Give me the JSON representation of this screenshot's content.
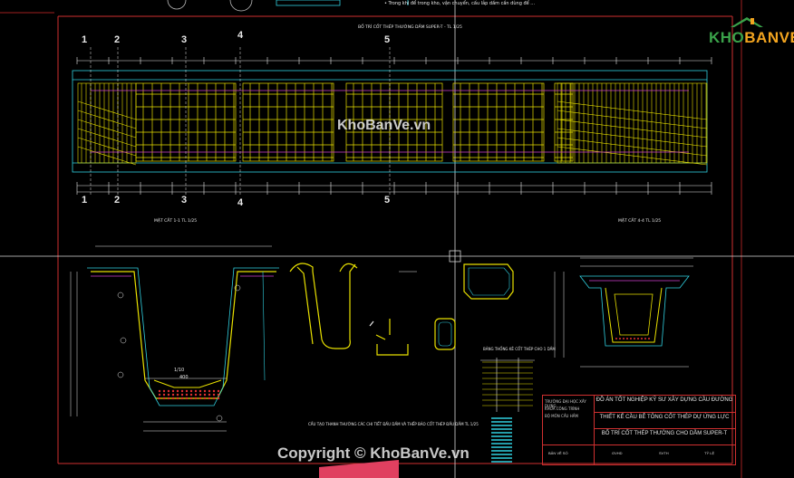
{
  "sheet": {
    "top_note": "• Trong khi để trong kho, vận chuyển, cấu lắp dầm cần dùng để ...",
    "plan_title": "BỐ TRÍ CỐT THÉP THƯỜNG DẦM SUPER-T - TL 1/25",
    "section_numbers_top": [
      "1",
      "2",
      "3",
      "4",
      "5"
    ],
    "section_numbers_bottom": [
      "1",
      "2",
      "3",
      "4",
      "5"
    ],
    "cross_section_left_label": "MẶT CẮT 1-1  TL 1/25",
    "cross_section_right_label": "MẶT CẮT 4-4  TL 1/25",
    "dim_width": "400",
    "dim_top": "1/10",
    "rebar_detail_note": "CẤU TẠO THANH THƯỜNG CÁC CHI TIẾT ĐẦU DẦM VÀ THẾP BẢO CỐT THÉP ĐẦU DẦM  TL 1/25",
    "table_title": "BẢNG THỐNG KÊ CỐT THÉP CHO 1 DẦM"
  },
  "title_block": {
    "left_lines": [
      "TRƯỜNG ĐẠI HỌC XÂY DỰNG",
      "KHOA CÔNG TRÌNH",
      "BỘ MÔN CẦU HẦM"
    ],
    "project": "ĐỒ ÁN TỐT NGHIỆP KỸ SƯ XÂY DỰNG CẦU ĐƯỜNG",
    "design": "THIẾT KẾ CẦU BÊ TÔNG CỐT THÉP DỰ ỨNG LỰC",
    "drawing": "BỐ TRÍ CỐT THÉP THƯỜNG CHO DẦM SUPER-T",
    "bottom_cells": [
      "BẢN VẼ SỐ",
      "GVHD",
      "SVTH",
      "TỶ LỆ"
    ]
  },
  "branding": {
    "logo_kho": "KHO",
    "logo_banve": "BANVE",
    "watermark_center": "KhoBanVe.vn",
    "watermark_bottom": "Copyright © KhoBanVe.vn"
  },
  "colors": {
    "background": "#000000",
    "frame_red": "#d03030",
    "rebar_yellow": "#e8e000",
    "concrete_cyan": "#30d0e0",
    "dim_white": "#e8e8e8",
    "bottom_bar_red": "#e04060"
  }
}
